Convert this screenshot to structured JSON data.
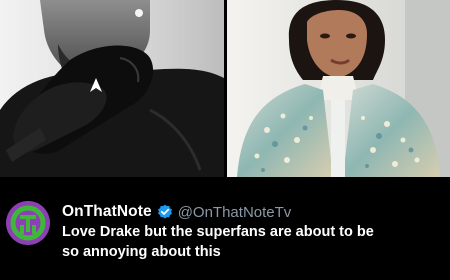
{
  "post": {
    "images": [
      {
        "icon": "monochrome-portrait-photo"
      },
      {
        "icon": "color-portrait-photo"
      }
    ],
    "author": {
      "display_name": "OnThatNote",
      "handle": "@OnThatNoteTv",
      "verified": true,
      "avatar_icon": "otn-logo-avatar",
      "avatar_color": "#8d3fb4",
      "logo_color": "#3fb83a"
    },
    "text": "Love Drake but the superfans are about to be so annoying about this"
  },
  "colors": {
    "background": "#000000",
    "name": "#ffffff",
    "handle": "#8b98a5",
    "verified_badge": "#1d9bf0"
  }
}
